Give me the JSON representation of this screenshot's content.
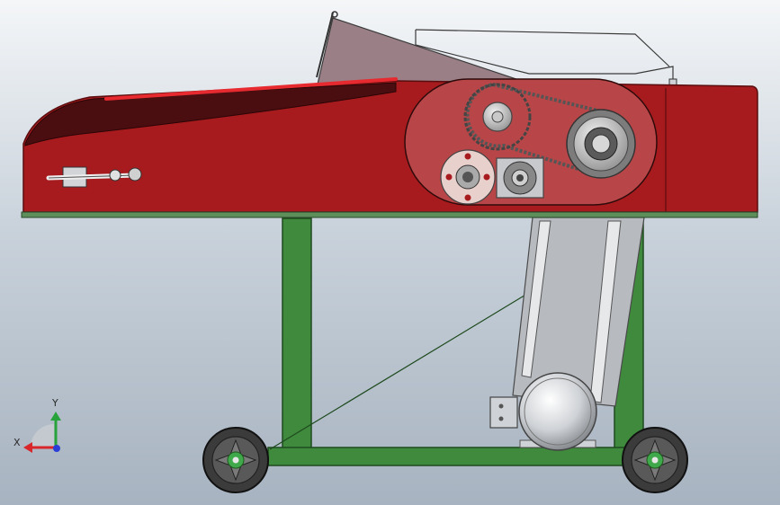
{
  "viewport": {
    "background_top": "#f4f6f8",
    "background_bottom": "#a7b3c0"
  },
  "model": {
    "body_color": "#a71b1e",
    "frame_color": "#3f8a3c",
    "hopper_color": "#9a7f86",
    "wheel_color": "#3b3b3b",
    "wheel_hub_color": "#3fa84a",
    "motor_color": "#d6d8dc"
  },
  "triad": {
    "x_label": "X",
    "y_label": "Y",
    "x_color": "#d8262b",
    "y_color": "#28a33c",
    "z_color": "#2b3fd6"
  }
}
